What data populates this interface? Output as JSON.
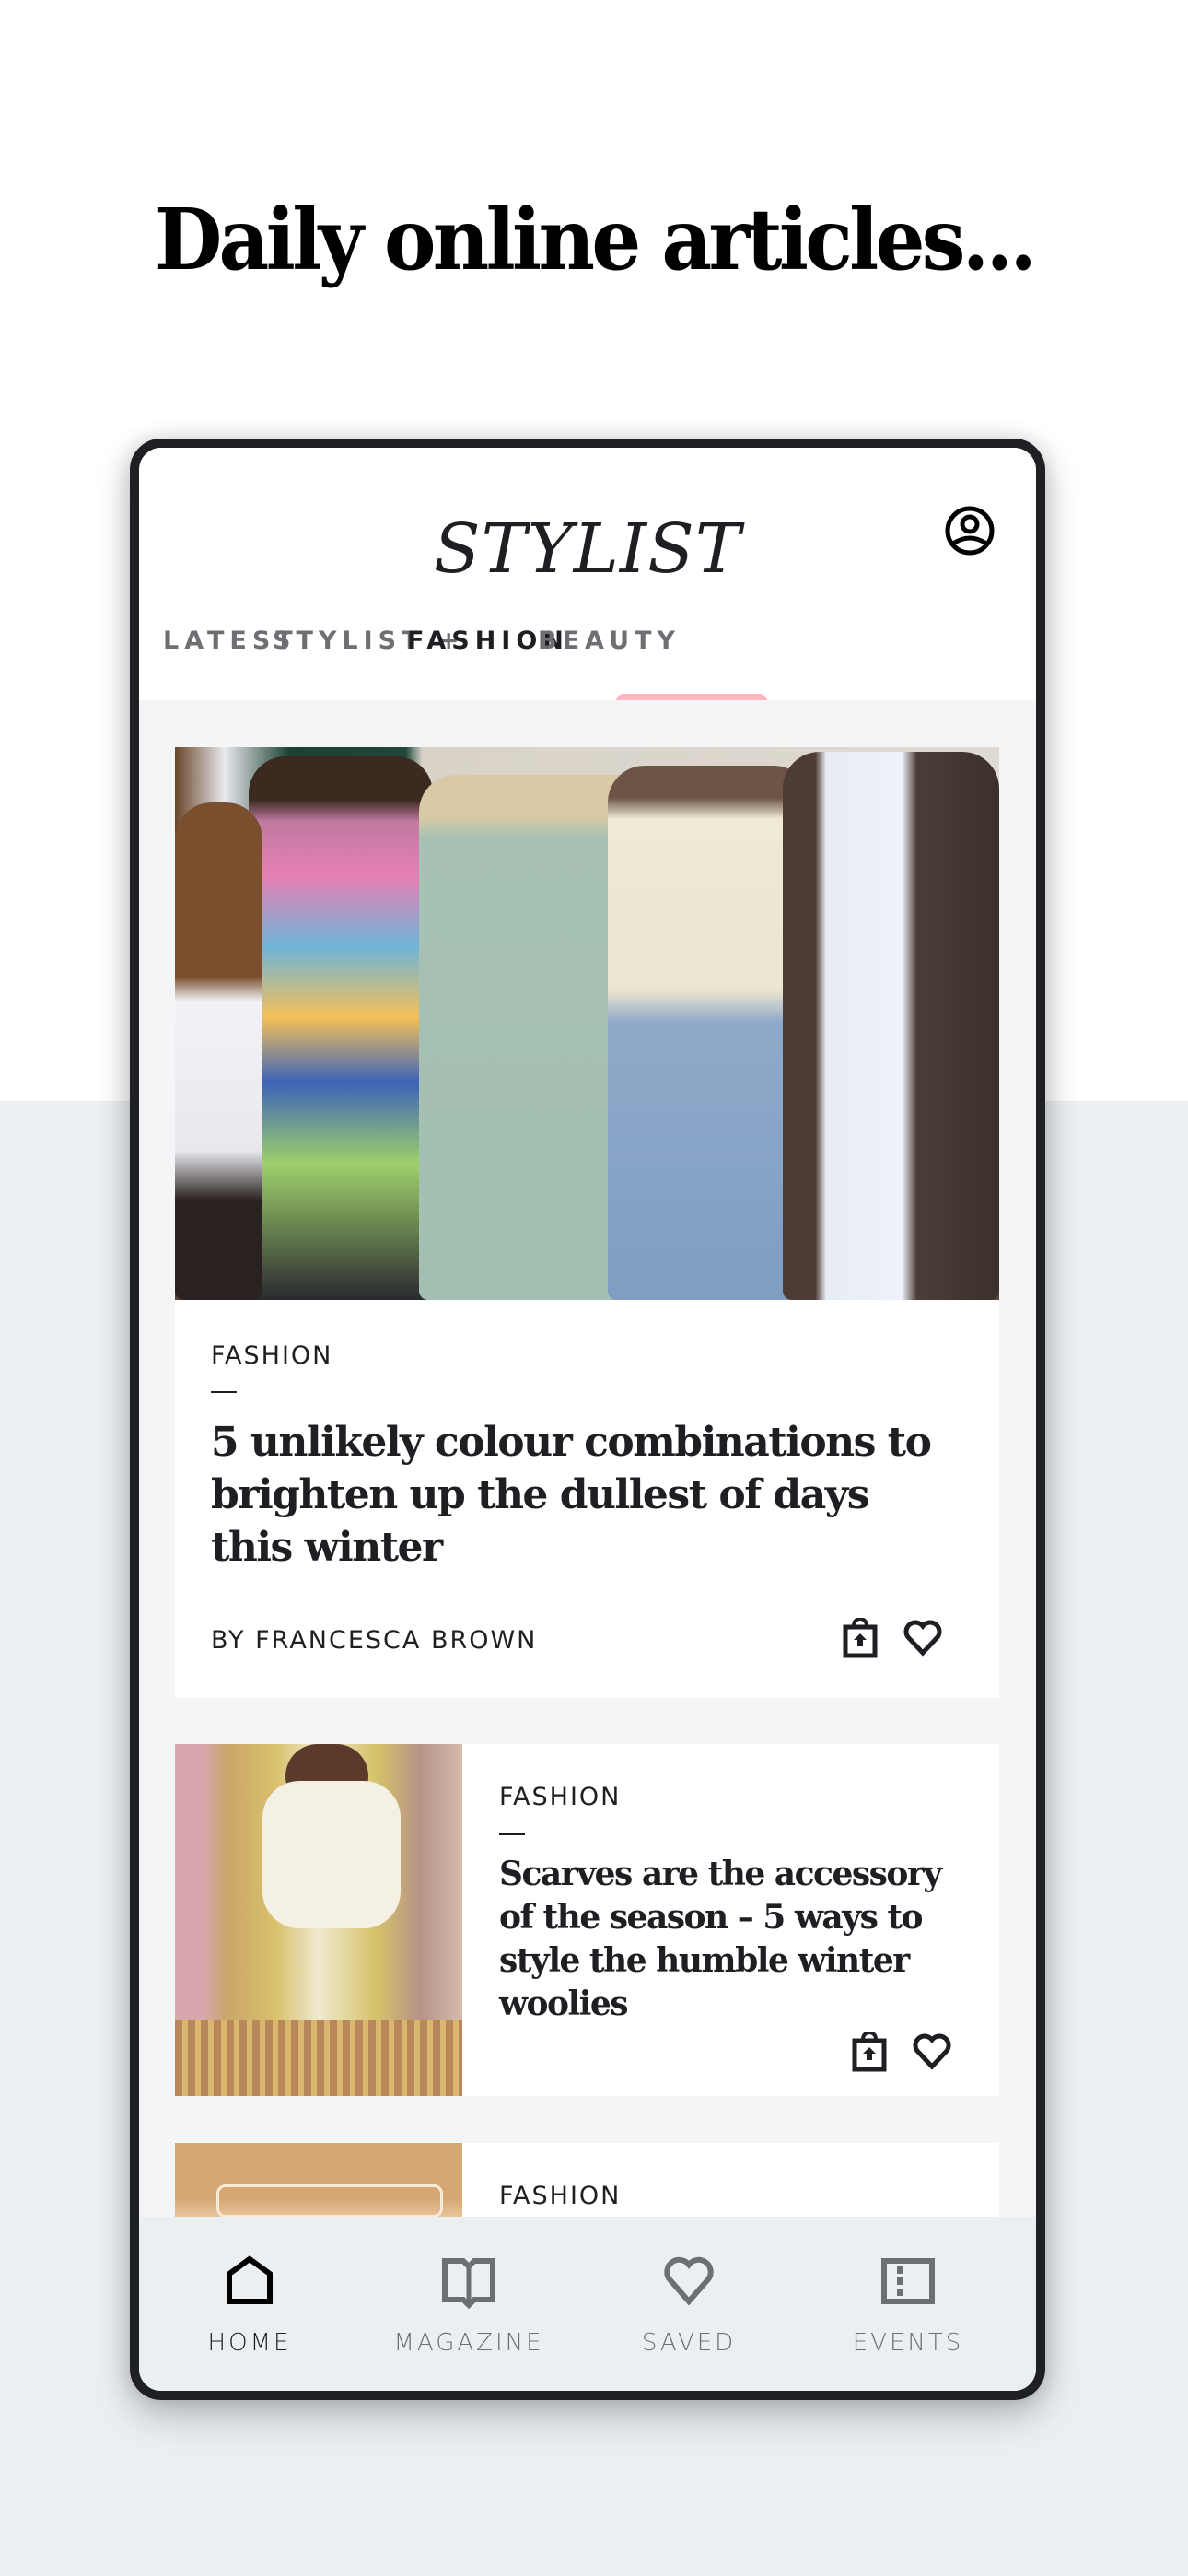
{
  "promo": {
    "title": "Daily online articles..."
  },
  "app": {
    "logo": "STYLIST",
    "profile_icon": "user-circle-icon",
    "tabs": [
      {
        "label": "LATEST",
        "active": false
      },
      {
        "label": "STYLIST +",
        "active": false
      },
      {
        "label": "FASHION",
        "active": true
      },
      {
        "label": "BEAUTY",
        "active": false
      }
    ],
    "accent_color": "#ffb6c1"
  },
  "articles": [
    {
      "category": "FASHION",
      "title": "5 unlikely colour combinations to brighten up the dullest of days this winter",
      "byline": "BY FRANCESCA BROWN",
      "image": "street-style-group-photo",
      "actions": [
        "shop-bag-icon",
        "heart-icon"
      ]
    },
    {
      "category": "FASHION",
      "title": "Scarves are the accessory of the season – 5 ways to style the humble winter woolies",
      "image": "yellow-scarf-photo",
      "actions": [
        "shop-bag-icon",
        "heart-icon"
      ]
    },
    {
      "category": "FASHION",
      "image": "neon-sign-photo"
    }
  ],
  "bottom_nav": [
    {
      "label": "HOME",
      "icon": "home-icon",
      "active": true
    },
    {
      "label": "MAGAZINE",
      "icon": "book-icon",
      "active": false
    },
    {
      "label": "SAVED",
      "icon": "heart-icon",
      "active": false
    },
    {
      "label": "EVENTS",
      "icon": "ticket-icon",
      "active": false
    }
  ]
}
